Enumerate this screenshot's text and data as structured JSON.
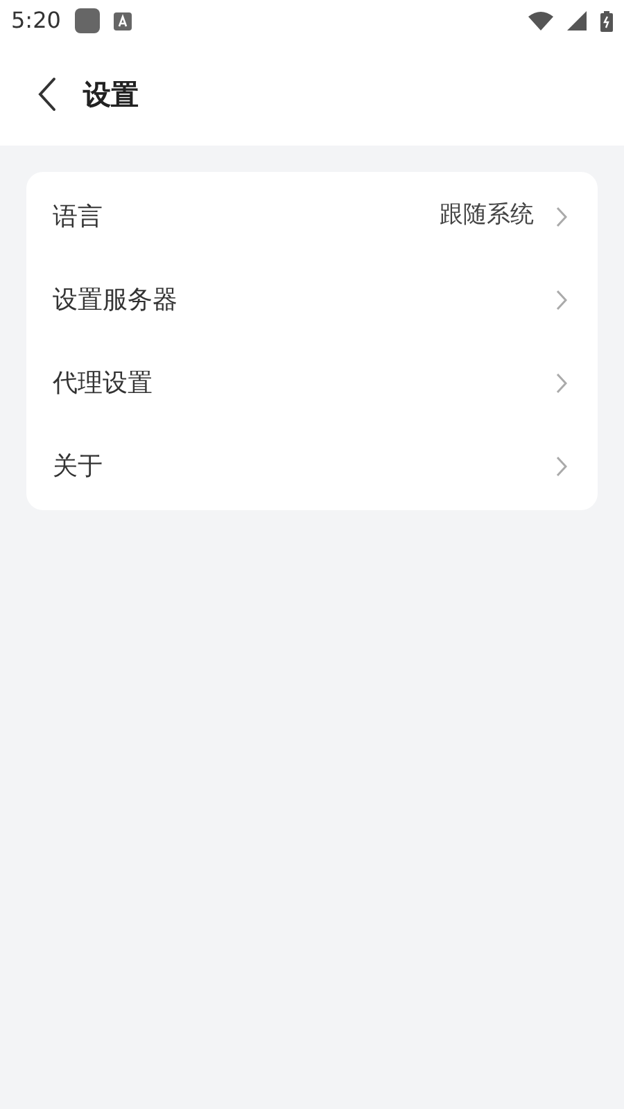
{
  "status_bar": {
    "time": "5:20"
  },
  "header": {
    "title": "设置"
  },
  "settings": [
    {
      "label": "语言",
      "value": "跟随系统"
    },
    {
      "label": "设置服务器"
    },
    {
      "label": "代理设置"
    },
    {
      "label": "关于"
    }
  ]
}
